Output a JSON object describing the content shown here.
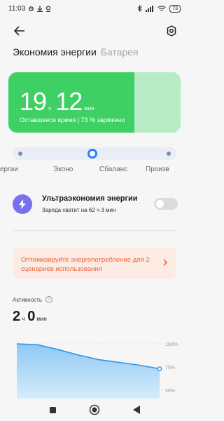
{
  "status_bar": {
    "time": "11:03",
    "battery": "73"
  },
  "tabs": [
    {
      "label": "Экономия энергии"
    },
    {
      "label": "Батарея"
    }
  ],
  "hero": {
    "hours": "19",
    "hours_unit": "ч",
    "minutes": "12",
    "minutes_unit": "мин",
    "subtitle": "Оставшееся время | 73 % заряжено"
  },
  "modes": {
    "labels": [
      "ергии",
      "Эконо",
      "Сбаланс",
      "Произв"
    ],
    "selected_index": 1
  },
  "ultra": {
    "title": "Ультраэкономия энергии",
    "subtitle": "Заряда хватит на 62 ч 3 мин",
    "enabled": false
  },
  "optimize": {
    "text": "Оптимизируйте энергопотребление для 2 сценариев использования"
  },
  "activity": {
    "label": "Активность",
    "hours": "2",
    "hours_unit": "ч",
    "minutes": "0",
    "minutes_unit": "мин"
  },
  "chart_data": {
    "type": "area",
    "y_ticks": [
      "100%",
      "75%",
      "50%"
    ],
    "values": [
      100,
      99,
      94,
      88,
      83,
      80,
      77,
      73
    ],
    "ylim": [
      50,
      100
    ],
    "color": "#2f95e6"
  },
  "colors": {
    "accent_green": "#3ed064",
    "accent_blue": "#1f82ff",
    "warning_orange": "#f0643c",
    "ultra_purple": "#7a6ff2"
  }
}
